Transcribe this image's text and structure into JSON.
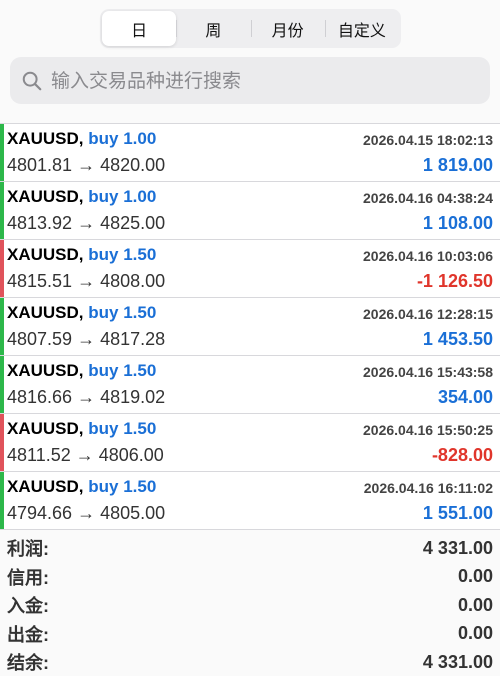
{
  "tabs": [
    {
      "label": "日",
      "active": true
    },
    {
      "label": "周",
      "active": false
    },
    {
      "label": "月份",
      "active": false
    },
    {
      "label": "自定义",
      "active": false
    }
  ],
  "search": {
    "placeholder": "输入交易品种进行搜索",
    "icon": "search-icon"
  },
  "colors": {
    "buy": "#1a6fd6",
    "profit_positive": "#1a6fd6",
    "profit_negative": "#e0352b",
    "bar_profit": "#2db84a",
    "bar_loss": "#e0535b"
  },
  "deals": [
    {
      "symbol": "XAUUSD,",
      "side": "buy 1.00",
      "prices": "4801.81 → 4820.00",
      "time": "2026.04.15 18:02:13",
      "profit": "1 819.00",
      "positive": true
    },
    {
      "symbol": "XAUUSD,",
      "side": "buy 1.00",
      "prices": "4813.92 → 4825.00",
      "time": "2026.04.16 04:38:24",
      "profit": "1 108.00",
      "positive": true
    },
    {
      "symbol": "XAUUSD,",
      "side": "buy 1.50",
      "prices": "4815.51 → 4808.00",
      "time": "2026.04.16 10:03:06",
      "profit": "-1 126.50",
      "positive": false
    },
    {
      "symbol": "XAUUSD,",
      "side": "buy 1.50",
      "prices": "4807.59 → 4817.28",
      "time": "2026.04.16 12:28:15",
      "profit": "1 453.50",
      "positive": true
    },
    {
      "symbol": "XAUUSD,",
      "side": "buy 1.50",
      "prices": "4816.66 → 4819.02",
      "time": "2026.04.16 15:43:58",
      "profit": "354.00",
      "positive": true
    },
    {
      "symbol": "XAUUSD,",
      "side": "buy 1.50",
      "prices": "4811.52 → 4806.00",
      "time": "2026.04.16 15:50:25",
      "profit": "-828.00",
      "positive": false
    },
    {
      "symbol": "XAUUSD,",
      "side": "buy 1.50",
      "prices": "4794.66 → 4805.00",
      "time": "2026.04.16 16:11:02",
      "profit": "1 551.00",
      "positive": true
    }
  ],
  "summary": [
    {
      "label": "利润:",
      "value": "4 331.00"
    },
    {
      "label": "信用:",
      "value": "0.00"
    },
    {
      "label": "入金:",
      "value": "0.00"
    },
    {
      "label": "出金:",
      "value": "0.00"
    },
    {
      "label": "结余:",
      "value": "4 331.00"
    }
  ]
}
